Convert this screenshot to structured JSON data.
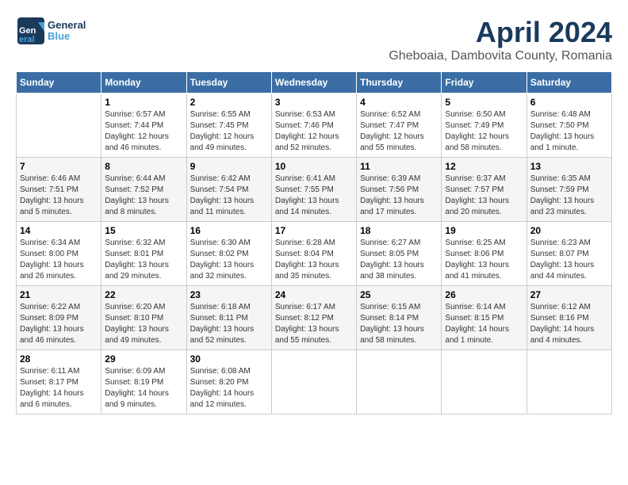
{
  "header": {
    "logo_general": "General",
    "logo_blue": "Blue",
    "title": "April 2024",
    "subtitle": "Gheboaia, Dambovita County, Romania"
  },
  "calendar": {
    "weekdays": [
      "Sunday",
      "Monday",
      "Tuesday",
      "Wednesday",
      "Thursday",
      "Friday",
      "Saturday"
    ],
    "weeks": [
      [
        {
          "day": "",
          "info": ""
        },
        {
          "day": "1",
          "info": "Sunrise: 6:57 AM\nSunset: 7:44 PM\nDaylight: 12 hours\nand 46 minutes."
        },
        {
          "day": "2",
          "info": "Sunrise: 6:55 AM\nSunset: 7:45 PM\nDaylight: 12 hours\nand 49 minutes."
        },
        {
          "day": "3",
          "info": "Sunrise: 6:53 AM\nSunset: 7:46 PM\nDaylight: 12 hours\nand 52 minutes."
        },
        {
          "day": "4",
          "info": "Sunrise: 6:52 AM\nSunset: 7:47 PM\nDaylight: 12 hours\nand 55 minutes."
        },
        {
          "day": "5",
          "info": "Sunrise: 6:50 AM\nSunset: 7:49 PM\nDaylight: 12 hours\nand 58 minutes."
        },
        {
          "day": "6",
          "info": "Sunrise: 6:48 AM\nSunset: 7:50 PM\nDaylight: 13 hours\nand 1 minute."
        }
      ],
      [
        {
          "day": "7",
          "info": "Sunrise: 6:46 AM\nSunset: 7:51 PM\nDaylight: 13 hours\nand 5 minutes."
        },
        {
          "day": "8",
          "info": "Sunrise: 6:44 AM\nSunset: 7:52 PM\nDaylight: 13 hours\nand 8 minutes."
        },
        {
          "day": "9",
          "info": "Sunrise: 6:42 AM\nSunset: 7:54 PM\nDaylight: 13 hours\nand 11 minutes."
        },
        {
          "day": "10",
          "info": "Sunrise: 6:41 AM\nSunset: 7:55 PM\nDaylight: 13 hours\nand 14 minutes."
        },
        {
          "day": "11",
          "info": "Sunrise: 6:39 AM\nSunset: 7:56 PM\nDaylight: 13 hours\nand 17 minutes."
        },
        {
          "day": "12",
          "info": "Sunrise: 6:37 AM\nSunset: 7:57 PM\nDaylight: 13 hours\nand 20 minutes."
        },
        {
          "day": "13",
          "info": "Sunrise: 6:35 AM\nSunset: 7:59 PM\nDaylight: 13 hours\nand 23 minutes."
        }
      ],
      [
        {
          "day": "14",
          "info": "Sunrise: 6:34 AM\nSunset: 8:00 PM\nDaylight: 13 hours\nand 26 minutes."
        },
        {
          "day": "15",
          "info": "Sunrise: 6:32 AM\nSunset: 8:01 PM\nDaylight: 13 hours\nand 29 minutes."
        },
        {
          "day": "16",
          "info": "Sunrise: 6:30 AM\nSunset: 8:02 PM\nDaylight: 13 hours\nand 32 minutes."
        },
        {
          "day": "17",
          "info": "Sunrise: 6:28 AM\nSunset: 8:04 PM\nDaylight: 13 hours\nand 35 minutes."
        },
        {
          "day": "18",
          "info": "Sunrise: 6:27 AM\nSunset: 8:05 PM\nDaylight: 13 hours\nand 38 minutes."
        },
        {
          "day": "19",
          "info": "Sunrise: 6:25 AM\nSunset: 8:06 PM\nDaylight: 13 hours\nand 41 minutes."
        },
        {
          "day": "20",
          "info": "Sunrise: 6:23 AM\nSunset: 8:07 PM\nDaylight: 13 hours\nand 44 minutes."
        }
      ],
      [
        {
          "day": "21",
          "info": "Sunrise: 6:22 AM\nSunset: 8:09 PM\nDaylight: 13 hours\nand 46 minutes."
        },
        {
          "day": "22",
          "info": "Sunrise: 6:20 AM\nSunset: 8:10 PM\nDaylight: 13 hours\nand 49 minutes."
        },
        {
          "day": "23",
          "info": "Sunrise: 6:18 AM\nSunset: 8:11 PM\nDaylight: 13 hours\nand 52 minutes."
        },
        {
          "day": "24",
          "info": "Sunrise: 6:17 AM\nSunset: 8:12 PM\nDaylight: 13 hours\nand 55 minutes."
        },
        {
          "day": "25",
          "info": "Sunrise: 6:15 AM\nSunset: 8:14 PM\nDaylight: 13 hours\nand 58 minutes."
        },
        {
          "day": "26",
          "info": "Sunrise: 6:14 AM\nSunset: 8:15 PM\nDaylight: 14 hours\nand 1 minute."
        },
        {
          "day": "27",
          "info": "Sunrise: 6:12 AM\nSunset: 8:16 PM\nDaylight: 14 hours\nand 4 minutes."
        }
      ],
      [
        {
          "day": "28",
          "info": "Sunrise: 6:11 AM\nSunset: 8:17 PM\nDaylight: 14 hours\nand 6 minutes."
        },
        {
          "day": "29",
          "info": "Sunrise: 6:09 AM\nSunset: 8:19 PM\nDaylight: 14 hours\nand 9 minutes."
        },
        {
          "day": "30",
          "info": "Sunrise: 6:08 AM\nSunset: 8:20 PM\nDaylight: 14 hours\nand 12 minutes."
        },
        {
          "day": "",
          "info": ""
        },
        {
          "day": "",
          "info": ""
        },
        {
          "day": "",
          "info": ""
        },
        {
          "day": "",
          "info": ""
        }
      ]
    ]
  }
}
